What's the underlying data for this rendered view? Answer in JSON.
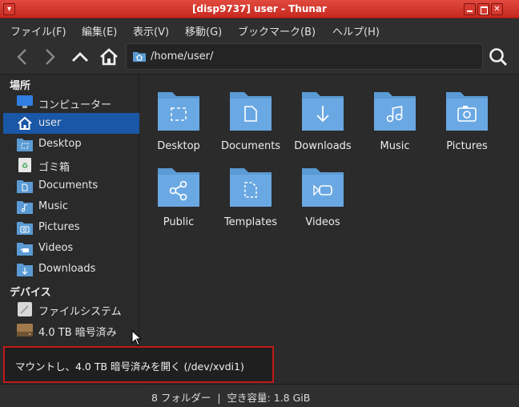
{
  "window": {
    "title": "[disp9737] user - Thunar"
  },
  "menubar": {
    "items": [
      "ファイル(F)",
      "編集(E)",
      "表示(V)",
      "移動(G)",
      "ブックマーク(B)",
      "ヘルプ(H)"
    ]
  },
  "toolbar": {
    "path": "/home/user/"
  },
  "sidebar": {
    "places_heading": "場所",
    "places": [
      {
        "label": "コンピューター",
        "icon": "computer-icon"
      },
      {
        "label": "user",
        "icon": "home-icon",
        "active": true
      },
      {
        "label": "Desktop",
        "icon": "desktop-folder-icon"
      },
      {
        "label": "ゴミ箱",
        "icon": "trash-icon"
      },
      {
        "label": "Documents",
        "icon": "documents-folder-icon"
      },
      {
        "label": "Music",
        "icon": "music-folder-icon"
      },
      {
        "label": "Pictures",
        "icon": "pictures-folder-icon"
      },
      {
        "label": "Videos",
        "icon": "videos-folder-icon"
      },
      {
        "label": "Downloads",
        "icon": "downloads-folder-icon"
      }
    ],
    "devices_heading": "デバイス",
    "devices": [
      {
        "label": "ファイルシステム",
        "icon": "filesystem-icon"
      },
      {
        "label": "4.0 TB 暗号済み",
        "icon": "drive-icon"
      }
    ]
  },
  "files": [
    {
      "label": "Desktop",
      "icon": "desktop"
    },
    {
      "label": "Documents",
      "icon": "documents"
    },
    {
      "label": "Downloads",
      "icon": "downloads"
    },
    {
      "label": "Music",
      "icon": "music"
    },
    {
      "label": "Pictures",
      "icon": "pictures"
    },
    {
      "label": "Public",
      "icon": "public"
    },
    {
      "label": "Templates",
      "icon": "templates"
    },
    {
      "label": "Videos",
      "icon": "videos"
    }
  ],
  "statusbar": {
    "text": "8 フォルダー  |  空き容量: 1.8 GiB"
  },
  "tooltip": {
    "text": "マウントし、4.0 TB 暗号済みを開く (/dev/xvdi1)"
  },
  "colors": {
    "accent": "#1a57a6",
    "folder": "#5b9bd5",
    "titlebar": "#d6392f"
  }
}
